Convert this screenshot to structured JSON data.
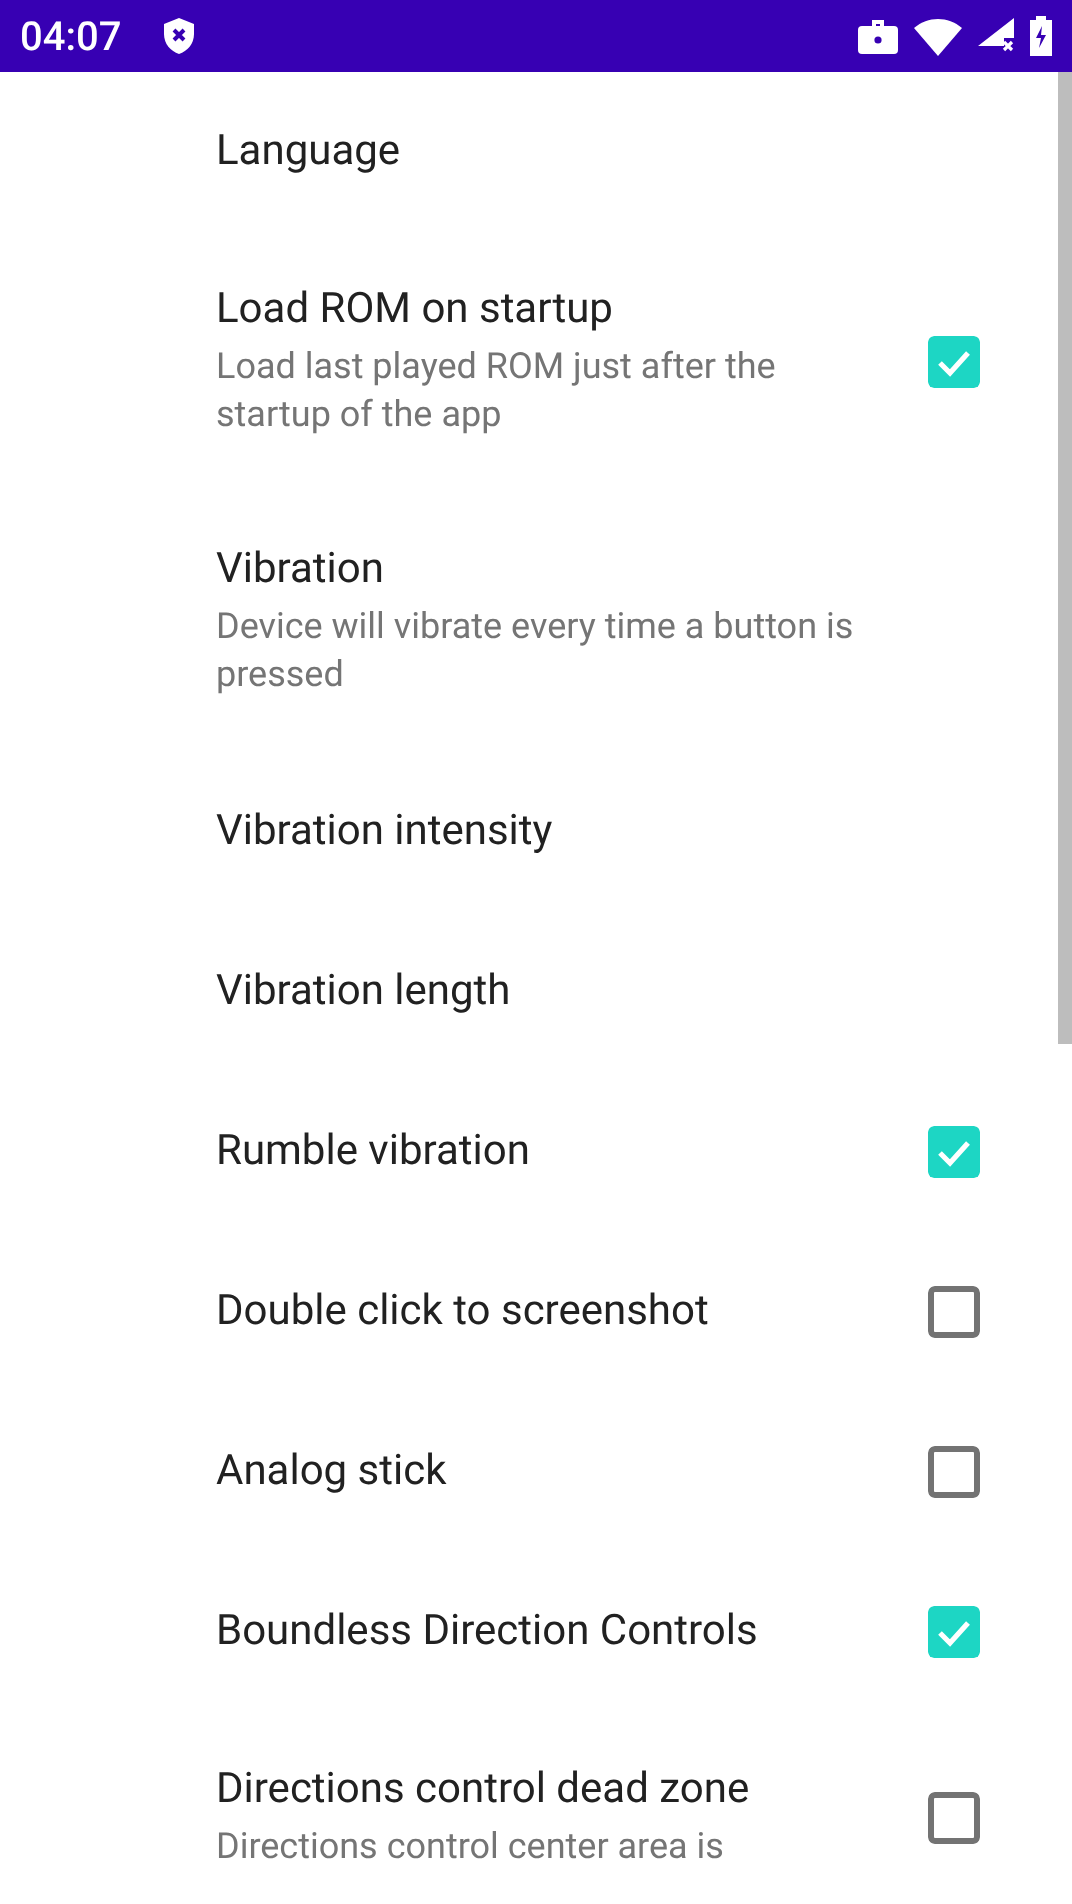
{
  "status_bar": {
    "time": "04:07"
  },
  "preferences": [
    {
      "kind": "plain",
      "title": "Language"
    },
    {
      "kind": "checkbox",
      "title": "Load ROM on startup",
      "summary": "Load last played ROM just after the startup of the app",
      "checked": true
    },
    {
      "kind": "plain",
      "title": "Vibration",
      "summary": "Device will vibrate every time a button is pressed"
    },
    {
      "kind": "plain",
      "title": "Vibration intensity"
    },
    {
      "kind": "plain",
      "title": "Vibration length"
    },
    {
      "kind": "checkbox",
      "title": "Rumble vibration",
      "checked": true
    },
    {
      "kind": "checkbox",
      "title": "Double click to screenshot",
      "checked": false
    },
    {
      "kind": "checkbox",
      "title": "Analog stick",
      "checked": false
    },
    {
      "kind": "checkbox",
      "title": "Boundless Direction Controls",
      "checked": true
    },
    {
      "kind": "checkbox",
      "title": "Directions control dead zone",
      "summary": "Directions control center area is",
      "checked": false
    }
  ]
}
